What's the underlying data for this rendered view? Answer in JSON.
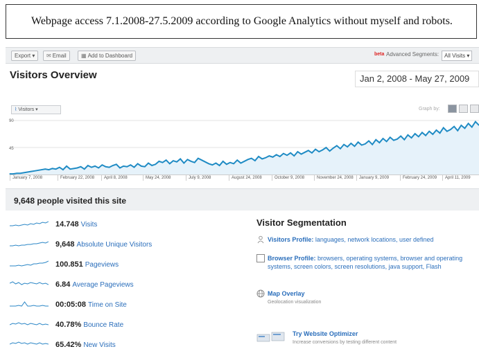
{
  "caption": "Webpage access 7.1.2008-27.5.2009 according to Google Analytics without myself and robots.",
  "toolbar": {
    "export_label": "Export",
    "email_label": "Email",
    "dashboard_label": "Add to Dashboard",
    "beta_label": "beta",
    "segments_label": "Advanced Segments:",
    "segments_value": "All Visits"
  },
  "header": {
    "title": "Visitors Overview",
    "date_range": "Jan 2, 2008 - May 27, 2009"
  },
  "graph_controls": {
    "metric_tab": "Visitors",
    "graph_by_label": "Graph by:"
  },
  "chart_data": {
    "type": "line",
    "title": "",
    "series": [
      {
        "name": "Visitors",
        "values": [
          1,
          1,
          2,
          2,
          3,
          4,
          5,
          6,
          7,
          8,
          9,
          8,
          10,
          9,
          12,
          8,
          14,
          9,
          10,
          11,
          13,
          9,
          15,
          12,
          14,
          11,
          16,
          13,
          12,
          15,
          17,
          11,
          14,
          13,
          16,
          12,
          18,
          14,
          13,
          19,
          15,
          17,
          22,
          20,
          24,
          18,
          23,
          21,
          26,
          19,
          25,
          22,
          20,
          27,
          24,
          21,
          18,
          16,
          19,
          15,
          22,
          17,
          20,
          18,
          24,
          19,
          22,
          25,
          27,
          23,
          30,
          26,
          28,
          31,
          29,
          33,
          30,
          35,
          32,
          36,
          31,
          38,
          34,
          37,
          40,
          36,
          42,
          38,
          41,
          45,
          39,
          44,
          48,
          43,
          50,
          46,
          52,
          47,
          54,
          49,
          51,
          56,
          50,
          58,
          53,
          60,
          55,
          62,
          57,
          59,
          64,
          58,
          66,
          61,
          68,
          63,
          70,
          65,
          72,
          67,
          74,
          69,
          78,
          72,
          75,
          80,
          73,
          82,
          77,
          85,
          79,
          88,
          82
        ]
      }
    ],
    "yticks": [
      "90",
      "45"
    ],
    "ylim": [
      0,
      90
    ],
    "x_tick_labels": [
      "January 7, 2008",
      "February 22, 2008",
      "April 8, 2008",
      "May 24, 2008",
      "July 9, 2008",
      "August 24, 2008",
      "October 9, 2008",
      "November 24, 2008",
      "January 9, 2009",
      "February 24, 2009",
      "April 11, 2009"
    ],
    "grid": true,
    "color": "#1f8bc4"
  },
  "summary": {
    "text": "9,648 people visited this site"
  },
  "metrics": [
    {
      "value": "14.748",
      "label": "Visits"
    },
    {
      "value": "9,648",
      "label": "Absolute Unique Visitors"
    },
    {
      "value": "100.851",
      "label": "Pageviews"
    },
    {
      "value": "6.84",
      "label": "Average Pageviews"
    },
    {
      "value": "00:05:08",
      "label": "Time on Site"
    },
    {
      "value": "40.78%",
      "label": "Bounce Rate"
    },
    {
      "value": "65.42%",
      "label": "New Visits"
    }
  ],
  "segmentation": {
    "title": "Visitor Segmentation",
    "visitors_profile_head": "Visitors Profile:",
    "visitors_profile_links": "languages, network locations, user defined",
    "browser_profile_head": "Browser Profile:",
    "browser_profile_links": "browsers, operating systems, browser and operating systems, screen colors, screen resolutions, java support, Flash",
    "map_overlay_head": "Map Overlay",
    "map_overlay_sub": "Geolocation visualization",
    "optimizer_head": "Try Website Optimizer",
    "optimizer_sub": "Increase conversions by testing different content"
  },
  "colors": {
    "accent": "#2a6ebb",
    "chart_line": "#1f8bc4",
    "beta": "#dd2222"
  }
}
